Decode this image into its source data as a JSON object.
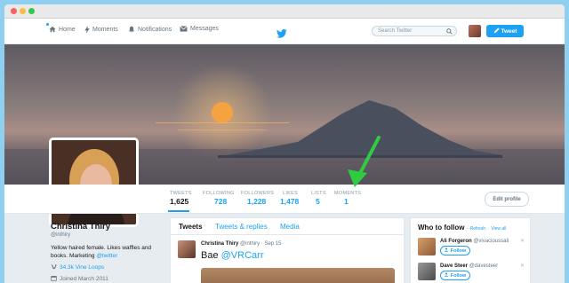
{
  "colors": {
    "accent": "#1da1f2",
    "arrow": "#2ecc40",
    "window_bg": "#8ecff2"
  },
  "nav": {
    "items": [
      {
        "label": "Home",
        "icon": "home-icon"
      },
      {
        "label": "Moments",
        "icon": "bolt-icon"
      },
      {
        "label": "Notifications",
        "icon": "bell-icon"
      },
      {
        "label": "Messages",
        "icon": "envelope-icon"
      }
    ],
    "search_placeholder": "Search Twitter",
    "tweet_button": "Tweet"
  },
  "stats": [
    {
      "label": "TWEETS",
      "value": "1,625"
    },
    {
      "label": "FOLLOWING",
      "value": "728"
    },
    {
      "label": "FOLLOWERS",
      "value": "1,228"
    },
    {
      "label": "LIKES",
      "value": "1,478"
    },
    {
      "label": "LISTS",
      "value": "5"
    },
    {
      "label": "MOMENTS",
      "value": "1"
    }
  ],
  "edit_profile": "Edit profile",
  "profile": {
    "name": "Christina Thiry",
    "handle": "@inthiry",
    "bio_text": "Yellow haired female. Likes waffles and books. Marketing ",
    "bio_link": "@twitter",
    "vine_loops": "34.3k Vine Loops",
    "joined": "Joined March 2011"
  },
  "timeline": {
    "tabs": [
      "Tweets",
      "Tweets & replies",
      "Media"
    ],
    "tweet": {
      "name": "Christina Thiry",
      "meta": "@inthiry · Sep 15",
      "text": "Bae ",
      "mention": "@VRCarr"
    }
  },
  "who_to_follow": {
    "title": "Who to follow",
    "refresh": "Refresh",
    "view_all": "View all",
    "separator": "·",
    "follow_label": "Follow",
    "users": [
      {
        "name": "Ali Forgeron",
        "handle": "@vivacioussali"
      },
      {
        "name": "Dave Steer",
        "handle": "@davesteer"
      }
    ]
  }
}
